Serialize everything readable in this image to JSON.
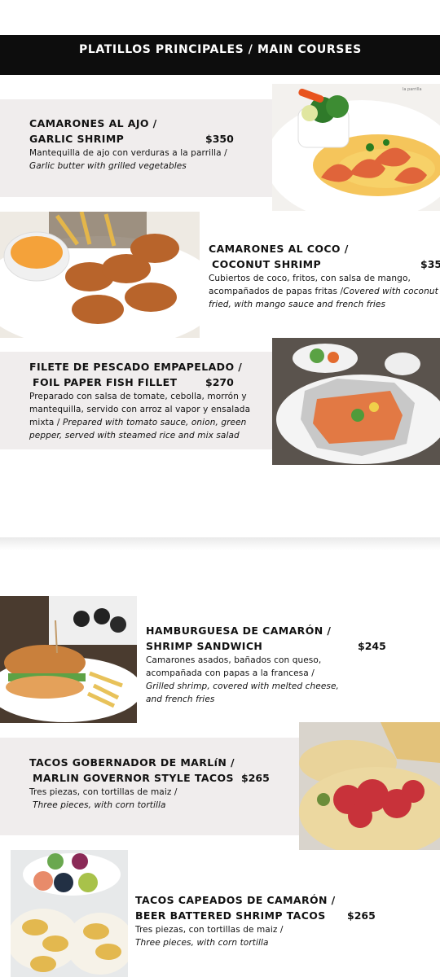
{
  "header": {
    "title": "PLATILLOS PRINCIPALES / MAIN COURSES"
  },
  "items": [
    {
      "title_es": "CAMARONES AL AJO /",
      "title_en": "GARLIC SHRIMP",
      "price": "$350",
      "desc_es": "Mantequilla de ajo con verduras a la parrilla /",
      "desc_en": "Garlic butter with grilled vegetables"
    },
    {
      "title_es": "CAMARONES AL COCO /",
      "title_en": "COCONUT SHRIMP",
      "price": "$35",
      "desc_l1": "Cubiertos de coco, fritos, con salsa de mango,",
      "desc_l2_es": "acompañados de papas fritas /",
      "desc_l2_en": "Covered with coconut",
      "desc_l3": "fried, with mango sauce and french fries"
    },
    {
      "title_es": "FILETE DE PESCADO EMPAPELADO /",
      "title_en": "FOIL PAPER FISH FILLET",
      "price": "$270",
      "desc_l1": "Preparado con salsa de tomate, cebolla, morrón y",
      "desc_l2": "mantequilla, servido con arroz al vapor y ensalada",
      "desc_l3_es": "mixta /",
      "desc_l3_en": "Prepared with tomato sauce, onion, green",
      "desc_l4": "pepper, served with steamed rice and mix salad"
    },
    {
      "title_es": "HAMBURGUESA DE CAMARÓN /",
      "title_en": "SHRIMP SANDWICH",
      "price": "$245",
      "desc_l1": "Camarones asados, bañados con queso,",
      "desc_l2": "acompañada con papas a la francesa /",
      "desc_l3": "Grilled shrimp, covered with melted cheese,",
      "desc_l4": "and french fries"
    },
    {
      "title_es": "TACOS GOBERNADOR DE MARLíN /",
      "title_en": "MARLIN GOVERNOR STYLE TACOS",
      "price": "$265",
      "desc_es": "Tres piezas, con tortillas de maiz /",
      "desc_en": "Three pieces, with corn tortilla"
    },
    {
      "title_es": "TACOS CAPEADOS DE CAMARÓN /",
      "title_en": "BEER BATTERED SHRIMP TACOS",
      "price": "$265",
      "desc_es": "Tres piezas, con tortillas de maiz /",
      "desc_en": "Three pieces, with corn tortilla"
    }
  ],
  "photos": [
    {
      "name": "garlic-shrimp-photo",
      "tag": "la parrilla"
    }
  ]
}
